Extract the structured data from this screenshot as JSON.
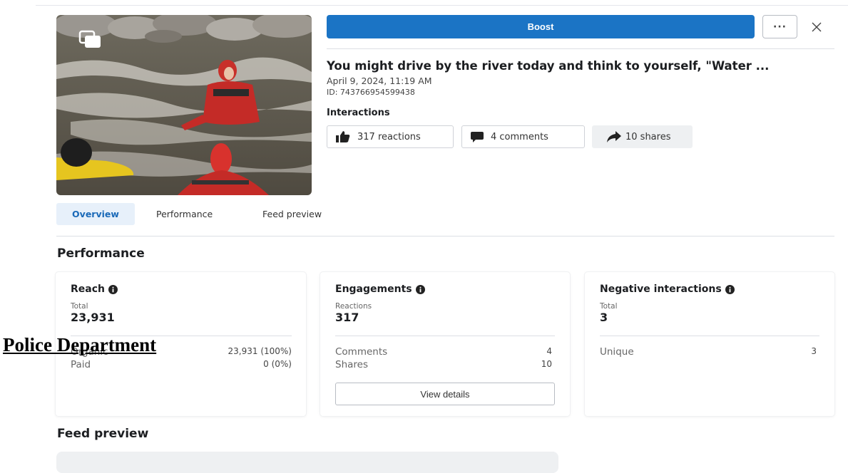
{
  "header": {
    "boost_label": "Boost",
    "more_label": "···",
    "close_icon": "close-icon"
  },
  "post": {
    "title": "You might drive by the river today and think to yourself, \"Water ...",
    "date": "April 9, 2024, 11:19 AM",
    "id": "ID: 743766954599438",
    "thumbnail_icon": "multiple-photos-icon"
  },
  "interactions": {
    "title": "Interactions",
    "reactions": "317 reactions",
    "comments": "4 comments",
    "shares": "10 shares"
  },
  "tabs": [
    {
      "label": "Overview",
      "active": true
    },
    {
      "label": "Performance",
      "active": false
    },
    {
      "label": "Feed preview",
      "active": false
    }
  ],
  "performance": {
    "title": "Performance",
    "reach": {
      "title": "Reach",
      "metric_label": "Total",
      "metric_value": "23,931",
      "rows": [
        {
          "label": "Organic",
          "value": "23,931 (100%)"
        },
        {
          "label": "Paid",
          "value": "0 (0%)"
        }
      ]
    },
    "engagements": {
      "title": "Engagements",
      "metric_label": "Reactions",
      "metric_value": "317",
      "rows": [
        {
          "label": "Comments",
          "value": "4"
        },
        {
          "label": "Shares",
          "value": "10"
        }
      ],
      "button": "View details"
    },
    "negative": {
      "title": "Negative interactions",
      "metric_label": "Total",
      "metric_value": "3",
      "rows": [
        {
          "label": "Unique",
          "value": "3"
        }
      ]
    }
  },
  "feed_preview": {
    "title": "Feed preview"
  },
  "overlay": {
    "caption": "Police Department"
  },
  "colors": {
    "accent": "#1b74c5",
    "tab_active_bg": "#e7f0fa",
    "tab_active_text": "#1b6ab8"
  }
}
